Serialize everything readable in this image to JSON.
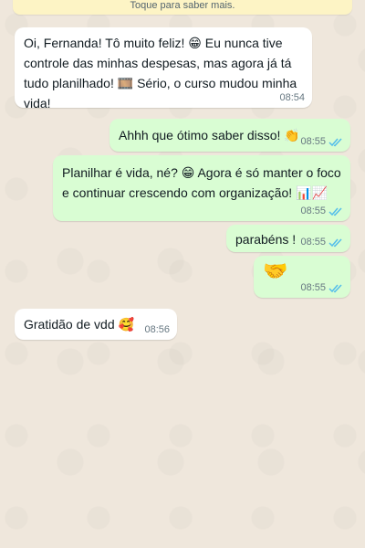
{
  "banner": {
    "text": "Toque para saber mais."
  },
  "messages": [
    {
      "direction": "in",
      "text": "Oi, Fernanda! Tô muito feliz! 😁 Eu nunca tive controle das minhas despesas, mas agora já tá tudo planilhado! 🎞️ Sério, o curso mudou minha vida!",
      "time": "08:54"
    },
    {
      "direction": "out",
      "text": "Ahhh que ótimo saber disso! 👏",
      "time": "08:55",
      "status": "read"
    },
    {
      "direction": "out",
      "text": "Planilhar é vida, né? 😁 Agora é só manter o foco e continuar crescendo com organização! 📊📈",
      "time": "08:55",
      "status": "read"
    },
    {
      "direction": "out",
      "text": "parabéns !",
      "time": "08:55",
      "status": "read"
    },
    {
      "direction": "out",
      "text": "🤝",
      "time": "08:55",
      "status": "read"
    },
    {
      "direction": "in",
      "text": "Gratidão de vdd 🥰",
      "time": "08:56"
    }
  ],
  "colors": {
    "incoming": "#ffffff",
    "outgoing": "#d9fdd3",
    "read_ticks": "#53bdeb",
    "wallpaper": "#efe7dc"
  }
}
